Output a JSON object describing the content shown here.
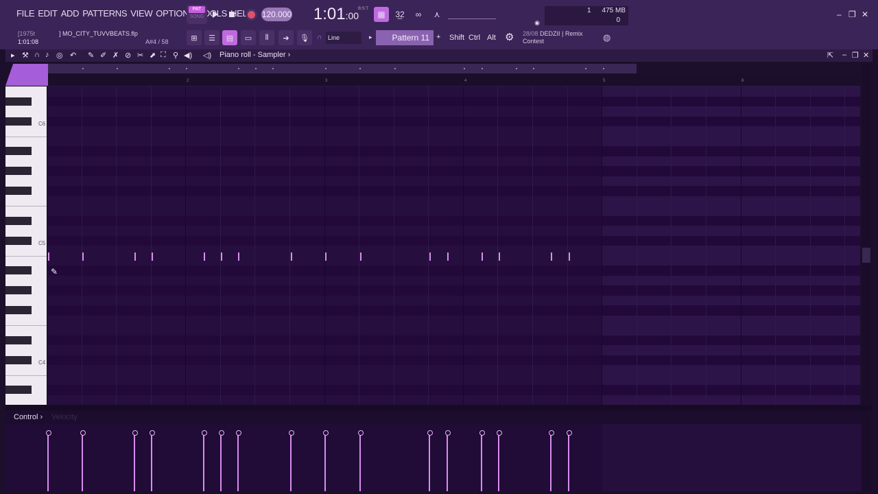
{
  "menu": [
    "FILE",
    "EDIT",
    "ADD",
    "PATTERNS",
    "VIEW",
    "OPTIONS",
    "TOOLS",
    "HELP"
  ],
  "transport": {
    "pat_label": "PAT",
    "song_label": "SONG",
    "tempo": "120.000",
    "time": "1:01",
    "time_ticks": ":00",
    "time_sup": "B:S:T"
  },
  "cpu": {
    "value1": "1",
    "memory": "475 MB",
    "value2": "0"
  },
  "hint": {
    "prefix": "[1975t",
    "filename": "] MO_CITY_TUVVBEATS.flp",
    "position": "1:01:08",
    "note": "A#4 / 58"
  },
  "snap": "Line",
  "pattern": "Pattern 11",
  "keys": {
    "shift": "Shift",
    "ctrl": "Ctrl",
    "alt": "Alt"
  },
  "news": {
    "date": "28/08",
    "text1": "DEDZII | Remix",
    "text2": "Contest"
  },
  "piano_roll": {
    "title": "Piano roll - Sampler",
    "ruler": [
      "2",
      "3",
      "4",
      "5",
      "6"
    ],
    "key_labels": [
      "C6",
      "C5",
      "C4"
    ]
  },
  "control": {
    "label": "Control",
    "target": "Velocity"
  },
  "notes_x": [
    70,
    120,
    196,
    221,
    297,
    322,
    347,
    424,
    474,
    525,
    626,
    652,
    702,
    727,
    803,
    829
  ],
  "colors": {
    "accent": "#c06ae0",
    "note": "#d890ee",
    "background": "#260f3f"
  }
}
